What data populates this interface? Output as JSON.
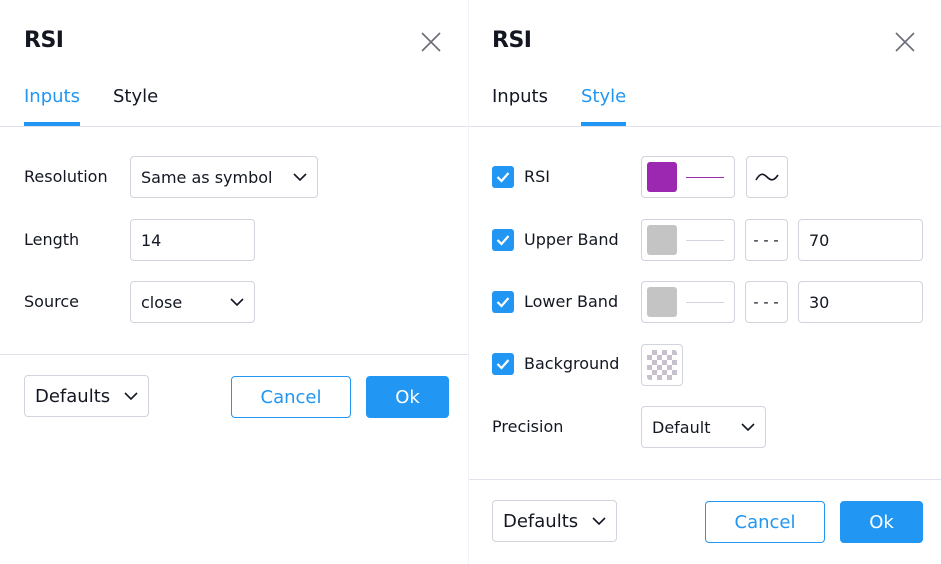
{
  "dialog_inputs": {
    "title": "RSI",
    "tabs": [
      {
        "label": "Inputs",
        "active": true
      },
      {
        "label": "Style",
        "active": false
      }
    ],
    "fields": {
      "resolution": {
        "label": "Resolution",
        "value": "Same as symbol"
      },
      "length": {
        "label": "Length",
        "value": "14"
      },
      "source": {
        "label": "Source",
        "value": "close"
      }
    },
    "footer": {
      "defaults_label": "Defaults",
      "cancel_label": "Cancel",
      "ok_label": "Ok"
    }
  },
  "dialog_style": {
    "title": "RSI",
    "tabs": [
      {
        "label": "Inputs",
        "active": false
      },
      {
        "label": "Style",
        "active": true
      }
    ],
    "rows": {
      "rsi": {
        "label": "RSI",
        "checked": true,
        "color": "#9c27b0",
        "line_color": "#9c27b0"
      },
      "upper_band": {
        "label": "Upper Band",
        "checked": true,
        "color": "#c4c4c4",
        "line_style": "dashed",
        "value": "70"
      },
      "lower_band": {
        "label": "Lower Band",
        "checked": true,
        "color": "#c4c4c4",
        "line_style": "dashed",
        "value": "30"
      },
      "background": {
        "label": "Background",
        "checked": true
      }
    },
    "precision": {
      "label": "Precision",
      "value": "Default"
    },
    "footer": {
      "defaults_label": "Defaults",
      "cancel_label": "Cancel",
      "ok_label": "Ok"
    }
  },
  "colors": {
    "accent": "#2196f3",
    "border": "#d1d4dc",
    "divider": "#e0e3eb",
    "text": "#131722"
  },
  "icons": {
    "close": "close-icon",
    "dropdown": "chevron-down-icon",
    "checkbox": "checkmark-icon",
    "plot_style": "line-wave-icon",
    "line_style": "dashed-line-icon"
  }
}
